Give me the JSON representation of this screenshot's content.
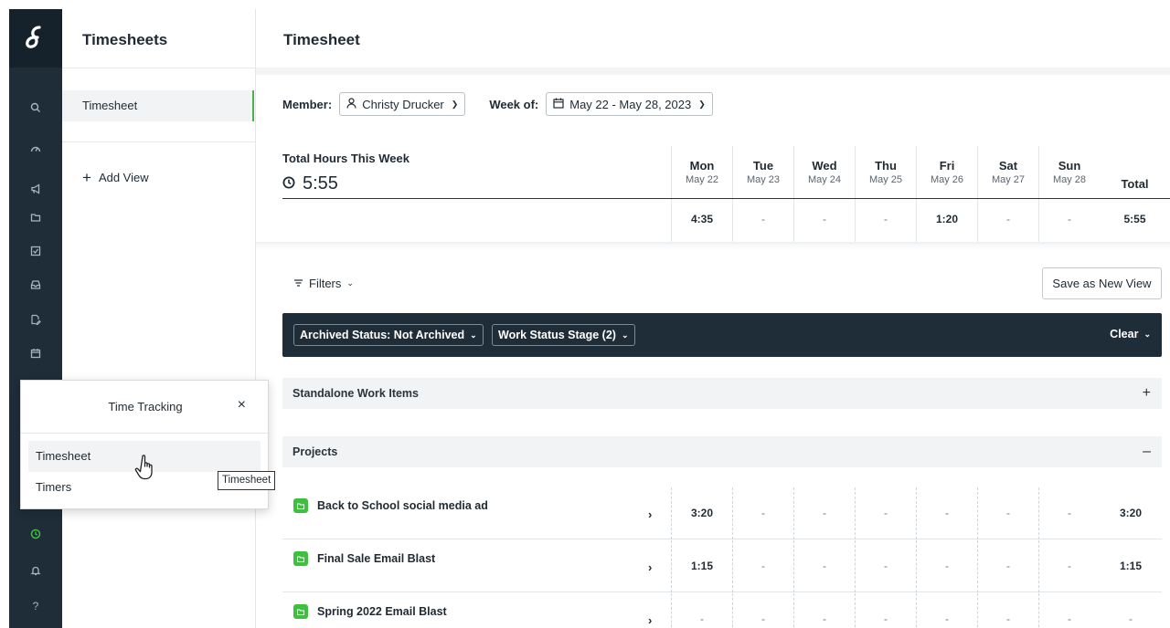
{
  "rail": {
    "icons": [
      "logo-icon",
      "search-icon",
      "dashboard-icon",
      "megaphone-icon",
      "folder-icon",
      "checkbox-icon",
      "inbox-icon",
      "document-edit-icon",
      "calendar-icon",
      "clock-icon",
      "bell-icon",
      "help-icon"
    ]
  },
  "sidebar": {
    "title": "Timesheets",
    "items": [
      {
        "label": "Timesheet",
        "active": true
      }
    ],
    "add_view": "Add View"
  },
  "header": {
    "title": "Timesheet"
  },
  "controls": {
    "member_label": "Member:",
    "member_value": "Christy Drucker",
    "week_label": "Week of:",
    "week_value": "May 22 - May 28, 2023"
  },
  "summary": {
    "label": "Total Hours This Week",
    "total": "5:55",
    "days": [
      {
        "day": "Mon",
        "date": "May 22",
        "value": "4:35"
      },
      {
        "day": "Tue",
        "date": "May 23",
        "value": "-"
      },
      {
        "day": "Wed",
        "date": "May 24",
        "value": "-"
      },
      {
        "day": "Thu",
        "date": "May 25",
        "value": "-"
      },
      {
        "day": "Fri",
        "date": "May 26",
        "value": "1:20"
      },
      {
        "day": "Sat",
        "date": "May 27",
        "value": "-"
      },
      {
        "day": "Sun",
        "date": "May 28",
        "value": "-"
      }
    ],
    "total_header": "Total",
    "total_value": "5:55"
  },
  "filters": {
    "label": "Filters",
    "save_view": "Save as New View",
    "chips": [
      "Archived Status: Not Archived",
      "Work Status Stage (2)"
    ],
    "clear": "Clear"
  },
  "sections": {
    "standalone": "Standalone Work Items",
    "projects": "Projects"
  },
  "projects": [
    {
      "name": "Back to School social media ad",
      "values": [
        "3:20",
        "-",
        "-",
        "-",
        "-",
        "-",
        "-"
      ],
      "total": "3:20"
    },
    {
      "name": "Final Sale Email Blast",
      "values": [
        "1:15",
        "-",
        "-",
        "-",
        "-",
        "-",
        "-"
      ],
      "total": "1:15"
    },
    {
      "name": "Spring 2022 Email Blast",
      "values": [
        "-",
        "-",
        "-",
        "-",
        "-",
        "-",
        "-"
      ],
      "total": "-"
    }
  ],
  "popover": {
    "title": "Time Tracking",
    "items": [
      "Timesheet",
      "Timers"
    ],
    "tooltip": "Timesheet"
  },
  "colors": {
    "rail": "#1f2d38",
    "accent": "#3fbf3f",
    "active_border": "#4caf50"
  }
}
